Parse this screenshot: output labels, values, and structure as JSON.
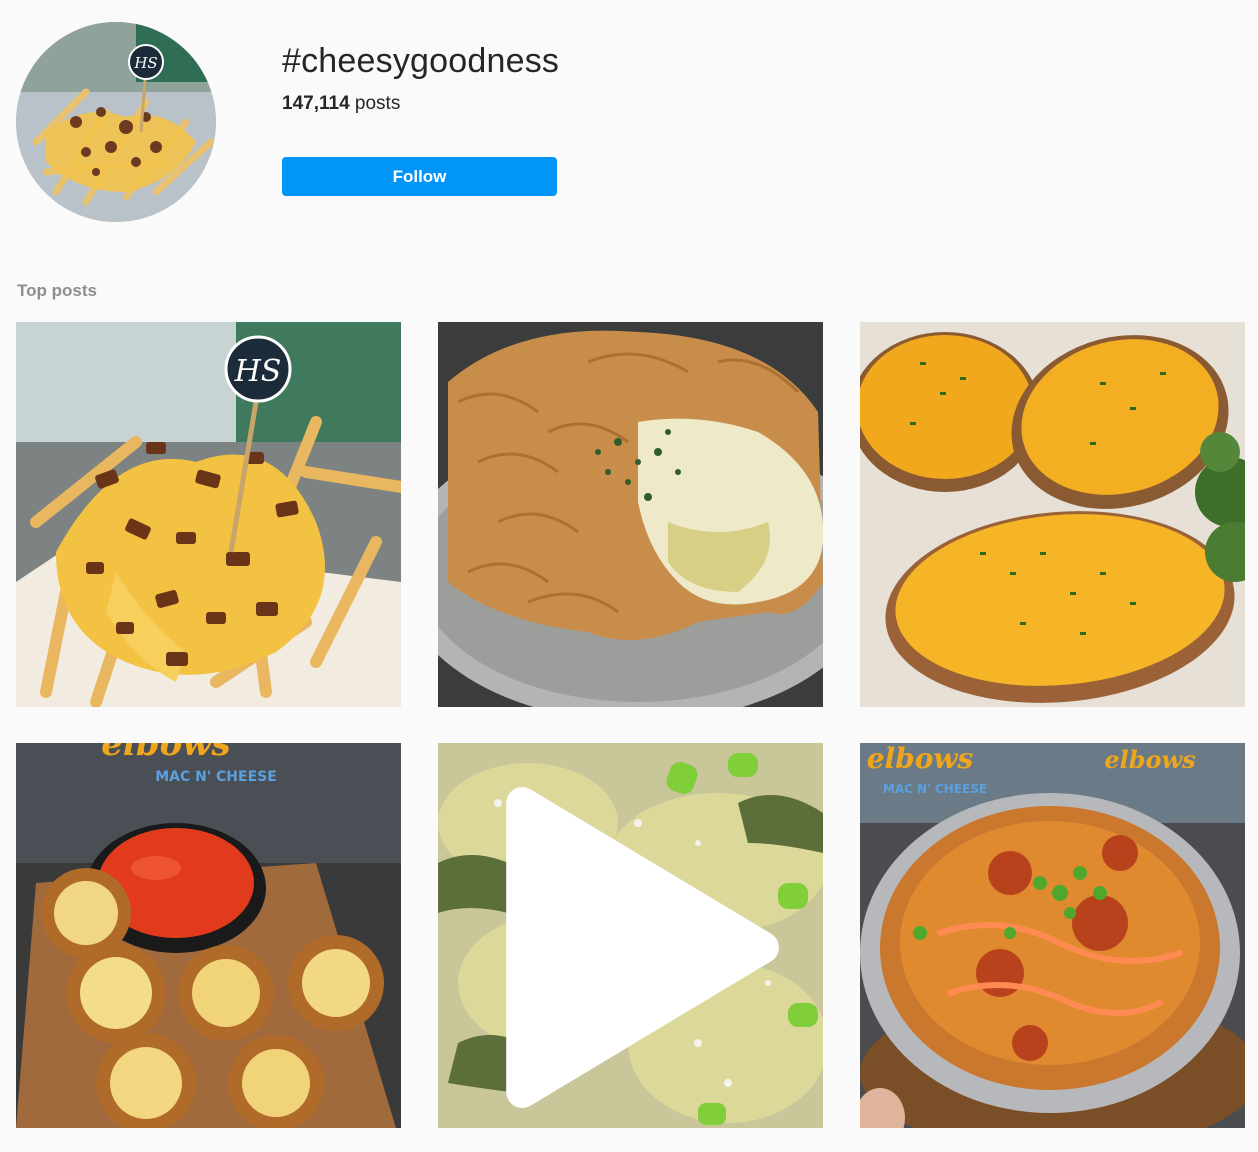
{
  "hashtag": {
    "title": "#cheesygoodness",
    "post_count": "147,114",
    "post_count_suffix": "posts",
    "follow_label": "Follow"
  },
  "colors": {
    "follow_button": "#0095f6",
    "page_background": "#fafafa",
    "secondary_text": "#8e8e8e"
  },
  "top_posts": {
    "label": "Top posts",
    "items": [
      {
        "subject": "Loaded cheese fries with bacon bits and HS pick",
        "video": false
      },
      {
        "subject": "Flaky phyllo pie with creamy cheese filling",
        "video": false
      },
      {
        "subject": "Twice-baked potatoes with cheddar and chives",
        "video": false
      },
      {
        "subject": "Fried mac and cheese balls with marinara dip",
        "video": false
      },
      {
        "subject": "Zucchini with cheese, scallions and feta crumbles",
        "video": true
      },
      {
        "subject": "Buffalo chicken mac and cheese in foil tray",
        "video": false
      }
    ]
  },
  "icons": {
    "video_badge": "play-icon"
  },
  "signs": {
    "hs_logo": "HS",
    "elbows": "elbows",
    "mac_n_cheese": "MAC N' CHEESE"
  }
}
